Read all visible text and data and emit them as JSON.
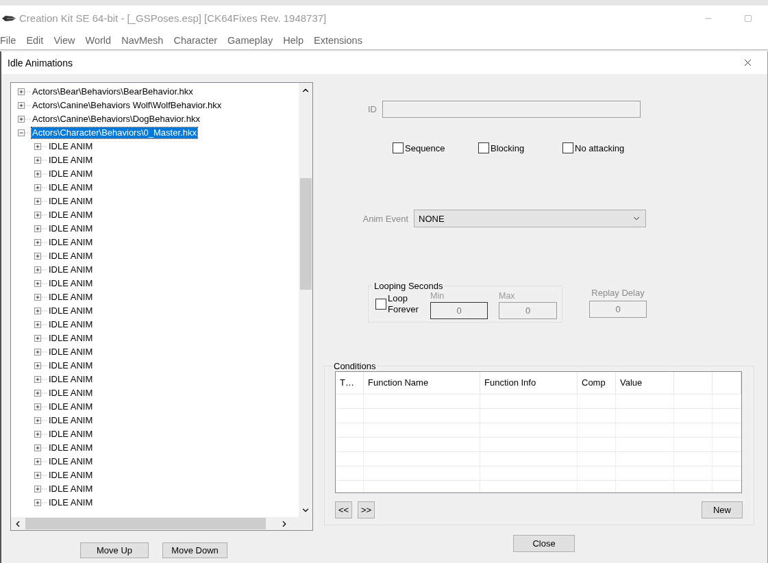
{
  "window": {
    "title": "Creation Kit SE 64-bit - [_GSPoses.esp] [CK64Fixes Rev. 1948737]"
  },
  "menu": [
    "File",
    "Edit",
    "View",
    "World",
    "NavMesh",
    "Character",
    "Gameplay",
    "Help",
    "Extensions"
  ],
  "dialog": {
    "title": "Idle Animations",
    "tree": [
      {
        "label": "Actors\\Bear\\Behaviors\\BearBehavior.hkx",
        "expanded": false,
        "selected": false
      },
      {
        "label": "Actors\\Canine\\Behaviors Wolf\\WolfBehavior.hkx",
        "expanded": false,
        "selected": false
      },
      {
        "label": "Actors\\Canine\\Behaviors\\DogBehavior.hkx",
        "expanded": false,
        "selected": false
      },
      {
        "label": "Actors\\Character\\Behaviors\\0_Master.hkx",
        "expanded": true,
        "selected": true,
        "children": [
          {
            "label": "IDLE ANIM",
            "expanded": false,
            "selected": false
          },
          {
            "label": "IDLE ANIM",
            "expanded": false,
            "selected": false
          },
          {
            "label": "IDLE ANIM",
            "expanded": false,
            "selected": false
          },
          {
            "label": "IDLE ANIM",
            "expanded": false,
            "selected": false
          },
          {
            "label": "IDLE ANIM",
            "expanded": false,
            "selected": false
          },
          {
            "label": "IDLE ANIM",
            "expanded": false,
            "selected": false
          },
          {
            "label": "IDLE ANIM",
            "expanded": false,
            "selected": false
          },
          {
            "label": "IDLE ANIM",
            "expanded": false,
            "selected": false
          },
          {
            "label": "IDLE ANIM",
            "expanded": false,
            "selected": false
          },
          {
            "label": "IDLE ANIM",
            "expanded": false,
            "selected": false
          },
          {
            "label": "IDLE ANIM",
            "expanded": false,
            "selected": false
          },
          {
            "label": "IDLE ANIM",
            "expanded": false,
            "selected": false
          },
          {
            "label": "IDLE ANIM",
            "expanded": false,
            "selected": false
          },
          {
            "label": "IDLE ANIM",
            "expanded": false,
            "selected": false
          },
          {
            "label": "IDLE ANIM",
            "expanded": false,
            "selected": false
          },
          {
            "label": "IDLE ANIM",
            "expanded": false,
            "selected": false
          },
          {
            "label": "IDLE ANIM",
            "expanded": false,
            "selected": false
          },
          {
            "label": "IDLE ANIM",
            "expanded": false,
            "selected": false
          },
          {
            "label": "IDLE ANIM",
            "expanded": false,
            "selected": false
          },
          {
            "label": "IDLE ANIM",
            "expanded": false,
            "selected": false
          },
          {
            "label": "IDLE ANIM",
            "expanded": false,
            "selected": false
          },
          {
            "label": "IDLE ANIM",
            "expanded": false,
            "selected": false
          },
          {
            "label": "IDLE ANIM",
            "expanded": false,
            "selected": false
          },
          {
            "label": "IDLE ANIM",
            "expanded": false,
            "selected": false
          },
          {
            "label": "IDLE ANIM",
            "expanded": false,
            "selected": false
          },
          {
            "label": "IDLE ANIM",
            "expanded": false,
            "selected": false
          },
          {
            "label": "IDLE ANIM",
            "expanded": false,
            "selected": false
          }
        ]
      }
    ],
    "tree_buttons": [
      "Move Up",
      "Move Down"
    ],
    "id": {
      "label": "ID"
    },
    "flags": [
      {
        "label": "Sequence",
        "checked": false
      },
      {
        "label": "Blocking",
        "checked": false
      },
      {
        "label": "No attacking",
        "checked": false
      }
    ],
    "anim_event": {
      "label": "Anim Event",
      "value": "NONE"
    },
    "looping": {
      "title": "Looping Seconds",
      "loop_forever": {
        "label": "Loop Forever",
        "checked": false
      },
      "min": {
        "label": "Min",
        "value": "0"
      },
      "max": {
        "label": "Max",
        "value": "0"
      }
    },
    "replay_delay": {
      "label": "Replay Delay",
      "value": "0"
    },
    "conditions": {
      "title": "Conditions",
      "columns": [
        "T…",
        "Function Name",
        "Function Info",
        "Comp",
        "Value"
      ],
      "nav_buttons": [
        "<<",
        ">>"
      ],
      "new_button": "New"
    },
    "close_button": "Close"
  }
}
